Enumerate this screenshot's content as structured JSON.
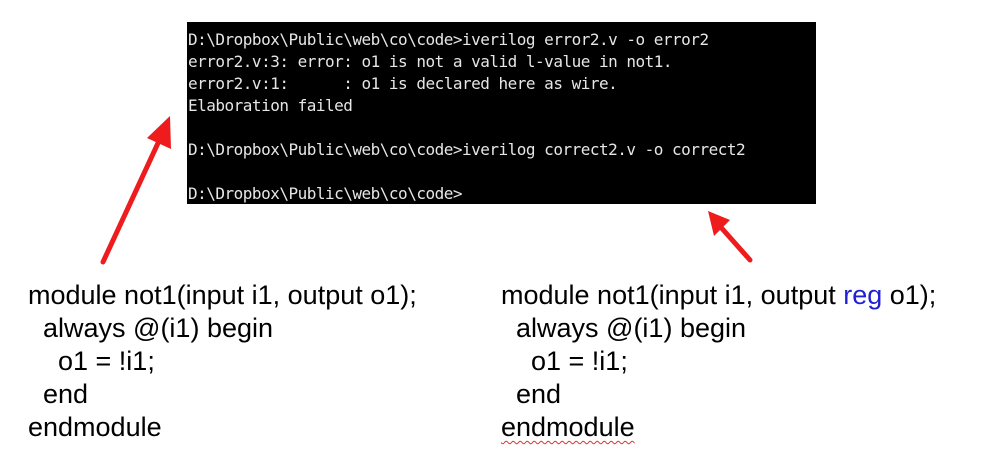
{
  "terminal": {
    "lines": [
      "D:\\Dropbox\\Public\\web\\co\\code>iverilog error2.v -o error2",
      "error2.v:3: error: o1 is not a valid l-value in not1.",
      "error2.v:1:      : o1 is declared here as wire.",
      "Elaboration failed",
      "",
      "D:\\Dropbox\\Public\\web\\co\\code>iverilog correct2.v -o correct2",
      "",
      "D:\\Dropbox\\Public\\web\\co\\code>"
    ]
  },
  "code_left": {
    "lines": [
      "module not1(input i1, output o1);",
      "  always @(i1) begin",
      "    o1 = !i1;",
      "  end",
      "endmodule"
    ]
  },
  "code_right": {
    "line1_prefix": "module not1(input i1, output ",
    "line1_keyword": "reg",
    "line1_suffix": " o1);",
    "lines": [
      "  always @(i1) begin",
      "    o1 = !i1;",
      "  end",
      "endmodule"
    ]
  },
  "colors": {
    "arrow": "#ee1c1c",
    "reg_keyword": "#1f1fd6",
    "terminal_bg": "#000000",
    "terminal_text": "#e6e6e6"
  }
}
